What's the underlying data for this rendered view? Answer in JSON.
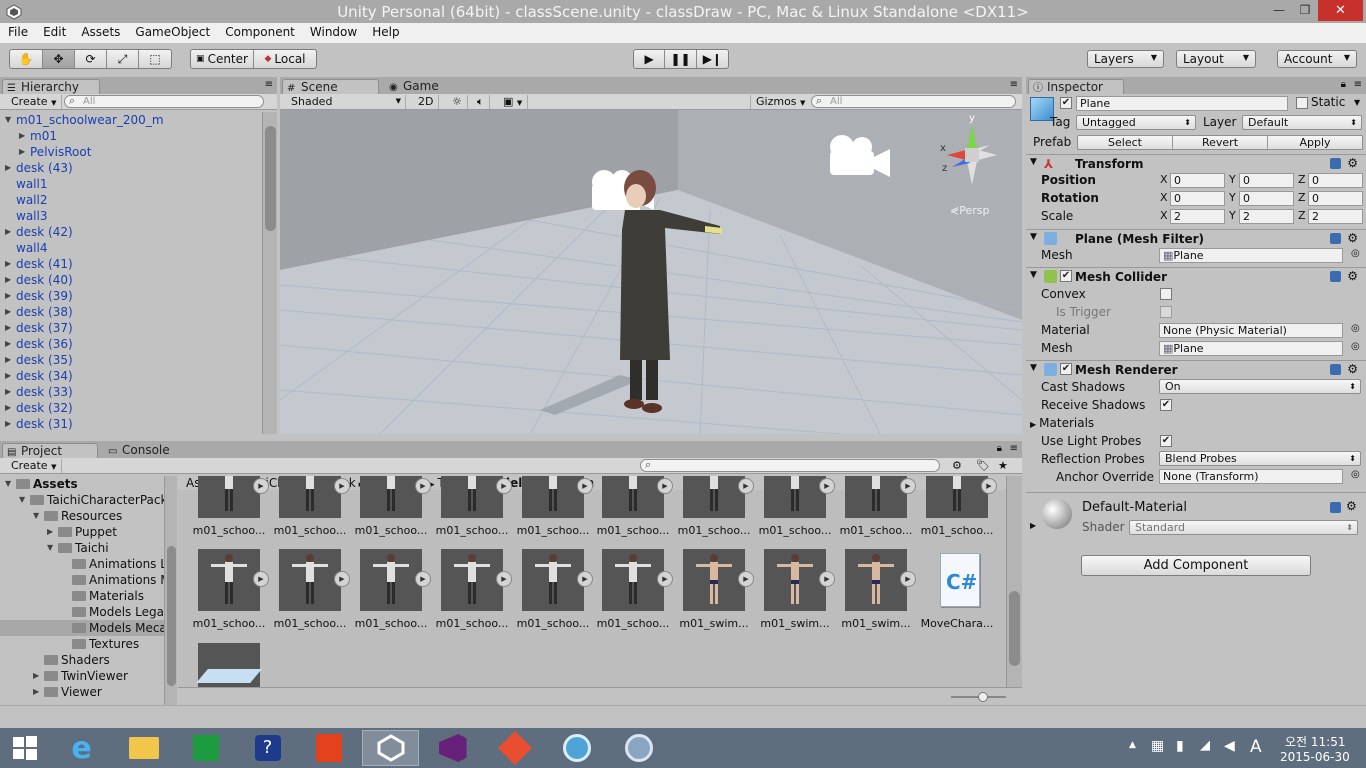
{
  "window": {
    "title": "Unity Personal (64bit) - classScene.unity - classDraw - PC, Mac & Linux Standalone <DX11>",
    "minimize": "—",
    "restore": "❐",
    "close": "✕"
  },
  "menu": [
    "File",
    "Edit",
    "Assets",
    "GameObject",
    "Component",
    "Window",
    "Help"
  ],
  "toolbar": {
    "pivot_center": "Center",
    "pivot_local": "Local",
    "layers": "Layers",
    "layout": "Layout",
    "account": "Account"
  },
  "hierarchy": {
    "tab": "Hierarchy",
    "create": "Create",
    "search_placeholder": "All",
    "items": [
      {
        "label": "m01_schoolwear_200_m",
        "indent": 0,
        "arrow": "open"
      },
      {
        "label": "m01",
        "indent": 1,
        "arrow": "closed"
      },
      {
        "label": "PelvisRoot",
        "indent": 1,
        "arrow": "closed"
      },
      {
        "label": "desk (43)",
        "indent": 0,
        "arrow": "closed"
      },
      {
        "label": "wall1",
        "indent": 0,
        "arrow": ""
      },
      {
        "label": "wall2",
        "indent": 0,
        "arrow": ""
      },
      {
        "label": "wall3",
        "indent": 0,
        "arrow": ""
      },
      {
        "label": "desk (42)",
        "indent": 0,
        "arrow": "closed"
      },
      {
        "label": "wall4",
        "indent": 0,
        "arrow": ""
      },
      {
        "label": "desk (41)",
        "indent": 0,
        "arrow": "closed"
      },
      {
        "label": "desk (40)",
        "indent": 0,
        "arrow": "closed"
      },
      {
        "label": "desk (39)",
        "indent": 0,
        "arrow": "closed"
      },
      {
        "label": "desk (38)",
        "indent": 0,
        "arrow": "closed"
      },
      {
        "label": "desk (37)",
        "indent": 0,
        "arrow": "closed"
      },
      {
        "label": "desk (36)",
        "indent": 0,
        "arrow": "closed"
      },
      {
        "label": "desk (35)",
        "indent": 0,
        "arrow": "closed"
      },
      {
        "label": "desk (34)",
        "indent": 0,
        "arrow": "closed"
      },
      {
        "label": "desk (33)",
        "indent": 0,
        "arrow": "closed"
      },
      {
        "label": "desk (32)",
        "indent": 0,
        "arrow": "closed"
      },
      {
        "label": "desk (31)",
        "indent": 0,
        "arrow": "closed"
      }
    ]
  },
  "scene": {
    "tab_scene": "Scene",
    "tab_game": "Game",
    "shading": "Shaded",
    "mode_2d": "2D",
    "gizmos": "Gizmos",
    "search_placeholder": "All",
    "persp": "Persp",
    "gizmo_y": "y",
    "gizmo_x": "x",
    "gizmo_z": "z"
  },
  "project": {
    "tab_project": "Project",
    "tab_console": "Console",
    "create": "Create",
    "tree": [
      {
        "label": "Assets",
        "indent": 0,
        "arrow": "open",
        "bold": true
      },
      {
        "label": "TaichiCharacterPack",
        "indent": 1,
        "arrow": "open"
      },
      {
        "label": "Resources",
        "indent": 2,
        "arrow": "open"
      },
      {
        "label": "Puppet",
        "indent": 3,
        "arrow": "closed"
      },
      {
        "label": "Taichi",
        "indent": 3,
        "arrow": "open"
      },
      {
        "label": "Animations Le",
        "indent": 4,
        "arrow": ""
      },
      {
        "label": "Animations M",
        "indent": 4,
        "arrow": ""
      },
      {
        "label": "Materials",
        "indent": 4,
        "arrow": ""
      },
      {
        "label": "Models Legac",
        "indent": 4,
        "arrow": ""
      },
      {
        "label": "Models Mecan",
        "indent": 4,
        "arrow": "",
        "selected": true
      },
      {
        "label": "Textures",
        "indent": 4,
        "arrow": ""
      },
      {
        "label": "Shaders",
        "indent": 2,
        "arrow": ""
      },
      {
        "label": "TwinViewer",
        "indent": 2,
        "arrow": "closed"
      },
      {
        "label": "Viewer",
        "indent": 2,
        "arrow": "closed"
      }
    ],
    "breadcrumb": [
      "Assets",
      "TaichiCharacterPack",
      "Resources",
      "Taichi",
      "Models Mecanim"
    ],
    "row1": [
      "m01_schoo...",
      "m01_schoo...",
      "m01_schoo...",
      "m01_schoo...",
      "m01_schoo...",
      "m01_schoo...",
      "m01_schoo...",
      "m01_schoo...",
      "m01_schoo...",
      "m01_schoo..."
    ],
    "row2": [
      "m01_schoo...",
      "m01_schoo...",
      "m01_schoo...",
      "m01_schoo...",
      "m01_schoo...",
      "m01_schoo...",
      "m01_swim...",
      "m01_swim...",
      "m01_swim...",
      "MoveChara..."
    ],
    "script_glyph": "C#"
  },
  "inspector": {
    "tab": "Inspector",
    "object_name": "Plane",
    "static": "Static",
    "tag_label": "Tag",
    "tag_value": "Untagged",
    "layer_label": "Layer",
    "layer_value": "Default",
    "prefab_label": "Prefab",
    "prefab_select": "Select",
    "prefab_revert": "Revert",
    "prefab_apply": "Apply",
    "transform": {
      "title": "Transform",
      "position_label": "Position",
      "rotation_label": "Rotation",
      "scale_label": "Scale",
      "position": [
        "0",
        "0",
        "0"
      ],
      "rotation": [
        "0",
        "0",
        "0"
      ],
      "scale": [
        "2",
        "2",
        "2"
      ],
      "x": "X",
      "y": "Y",
      "z": "Z"
    },
    "mesh_filter": {
      "title": "Plane (Mesh Filter)",
      "mesh_label": "Mesh",
      "mesh_value": "Plane"
    },
    "mesh_collider": {
      "title": "Mesh Collider",
      "convex_label": "Convex",
      "is_trigger_label": "Is Trigger",
      "material_label": "Material",
      "material_value": "None (Physic Material)",
      "mesh_label": "Mesh",
      "mesh_value": "Plane"
    },
    "mesh_renderer": {
      "title": "Mesh Renderer",
      "cast_shadows_label": "Cast Shadows",
      "cast_shadows_value": "On",
      "receive_shadows_label": "Receive Shadows",
      "materials_label": "Materials",
      "use_light_probes_label": "Use Light Probes",
      "reflection_probes_label": "Reflection Probes",
      "reflection_probes_value": "Blend Probes",
      "anchor_override_label": "Anchor Override",
      "anchor_override_value": "None (Transform)"
    },
    "material": {
      "name": "Default-Material",
      "shader_label": "Shader",
      "shader_value": "Standard"
    },
    "add_component": "Add Component"
  },
  "taskbar": {
    "apps": [
      "windows-start",
      "internet-explorer",
      "file-explorer",
      "store",
      "help",
      "office",
      "unity",
      "visual-studio",
      "git",
      "sourcetree",
      "remote-tool"
    ],
    "ime": "A",
    "time": "오전 11:51",
    "date": "2015-06-30"
  },
  "colors": {
    "titlebar": "#a9a9a9",
    "close": "#c7302b",
    "panel": "#c2c2c2",
    "hierarchy_text": "#1a3fb0",
    "taskbar": "#5f6e7f"
  }
}
